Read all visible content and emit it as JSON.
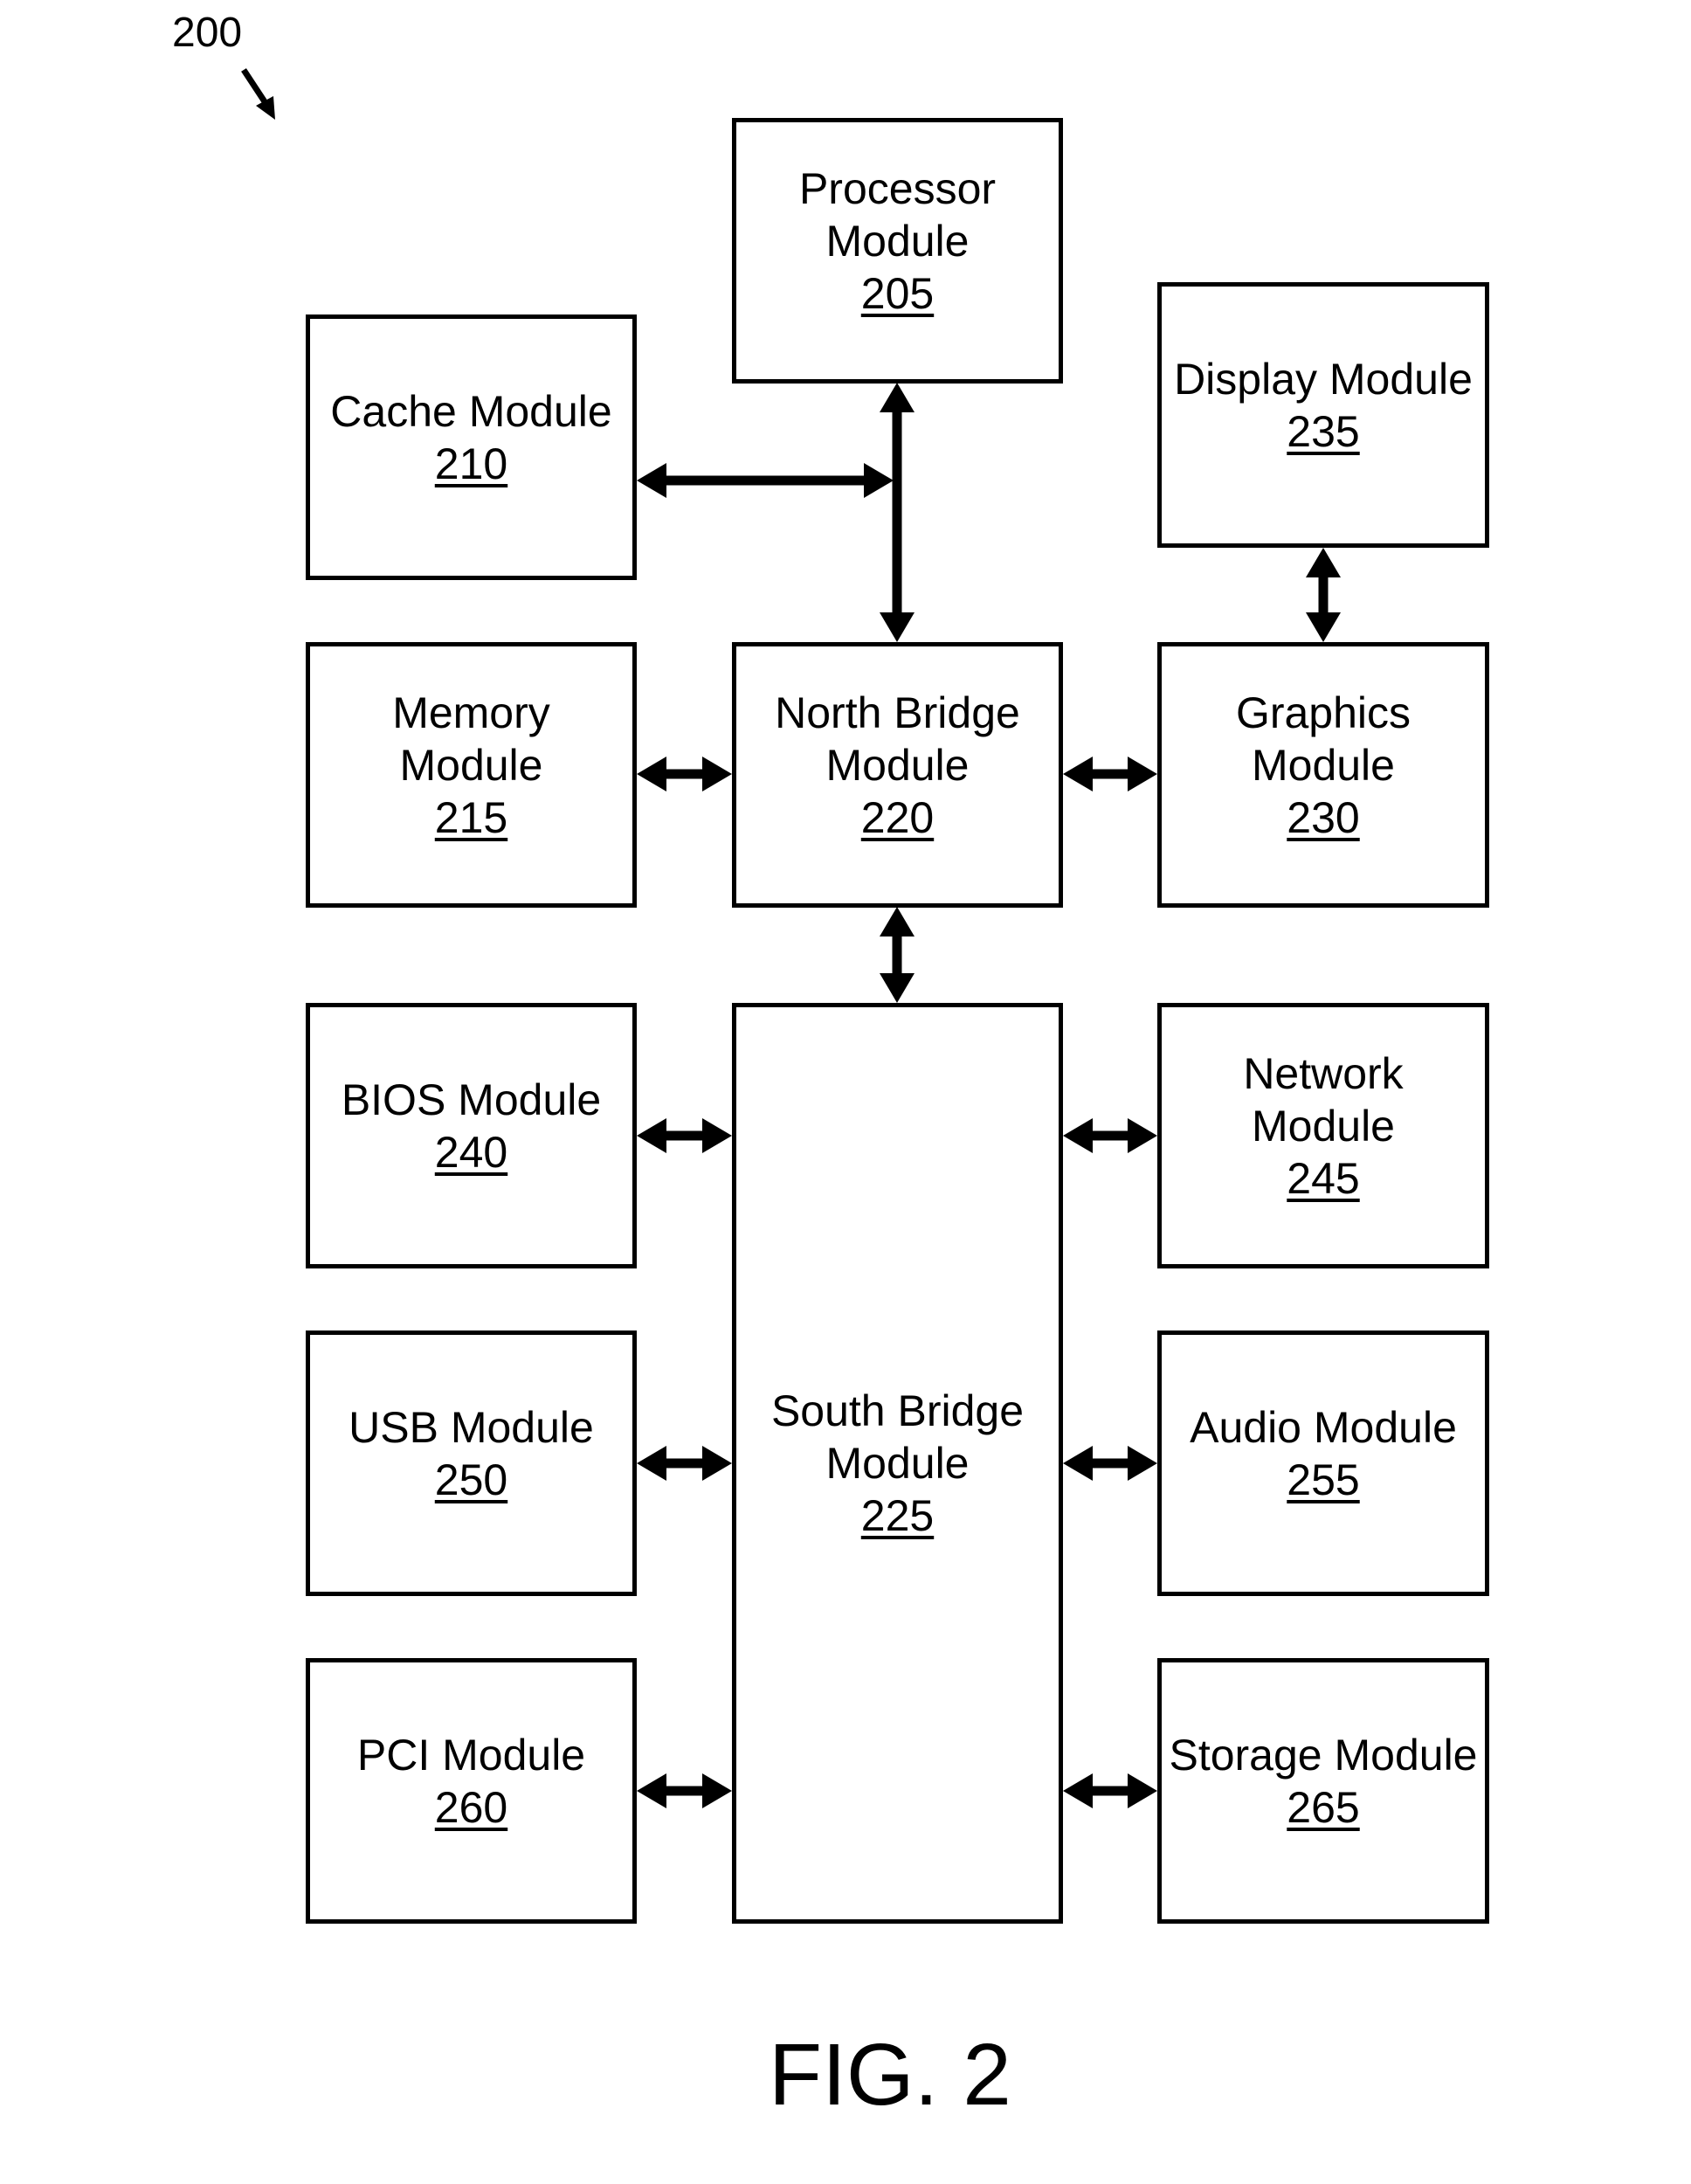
{
  "figure": {
    "reference_number": "200",
    "caption": "FIG. 2"
  },
  "modules": {
    "processor": {
      "name": "Processor\nModule",
      "ref": "205"
    },
    "cache": {
      "name": "Cache Module",
      "ref": "210"
    },
    "memory": {
      "name": "Memory\nModule",
      "ref": "215"
    },
    "north_bridge": {
      "name": "North Bridge\nModule",
      "ref": "220"
    },
    "south_bridge": {
      "name": "South Bridge\nModule",
      "ref": "225"
    },
    "graphics": {
      "name": "Graphics\nModule",
      "ref": "230"
    },
    "display": {
      "name": "Display Module",
      "ref": "235"
    },
    "bios": {
      "name": "BIOS Module",
      "ref": "240"
    },
    "network": {
      "name": "Network\nModule",
      "ref": "245"
    },
    "usb": {
      "name": "USB Module",
      "ref": "250"
    },
    "audio": {
      "name": "Audio Module",
      "ref": "255"
    },
    "pci": {
      "name": "PCI Module",
      "ref": "260"
    },
    "storage": {
      "name": "Storage Module",
      "ref": "265"
    }
  },
  "connections": [
    {
      "from": "cache",
      "to": "processor-northbridge bus",
      "type": "bidirectional"
    },
    {
      "from": "processor",
      "to": "north_bridge",
      "type": "bidirectional"
    },
    {
      "from": "display",
      "to": "graphics",
      "type": "bidirectional"
    },
    {
      "from": "memory",
      "to": "north_bridge",
      "type": "bidirectional"
    },
    {
      "from": "north_bridge",
      "to": "graphics",
      "type": "bidirectional"
    },
    {
      "from": "north_bridge",
      "to": "south_bridge",
      "type": "bidirectional"
    },
    {
      "from": "bios",
      "to": "south_bridge",
      "type": "bidirectional"
    },
    {
      "from": "south_bridge",
      "to": "network",
      "type": "bidirectional"
    },
    {
      "from": "usb",
      "to": "south_bridge",
      "type": "bidirectional"
    },
    {
      "from": "south_bridge",
      "to": "audio",
      "type": "bidirectional"
    },
    {
      "from": "pci",
      "to": "south_bridge",
      "type": "bidirectional"
    },
    {
      "from": "south_bridge",
      "to": "storage",
      "type": "bidirectional"
    }
  ]
}
